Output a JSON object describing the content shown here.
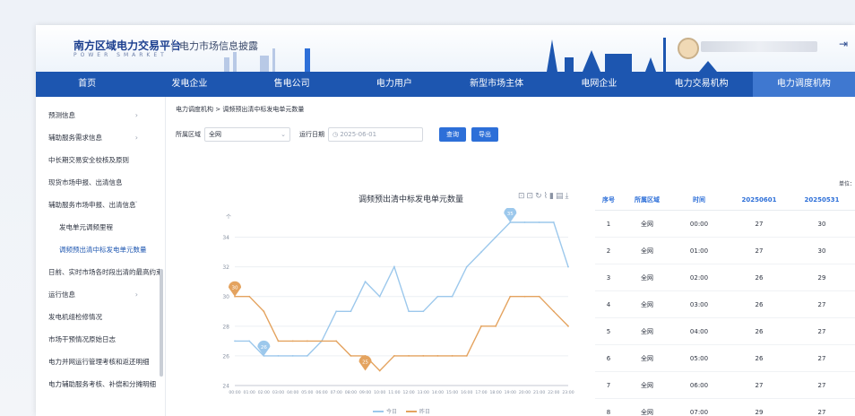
{
  "header": {
    "platform_title": "南方区域电力交易平台",
    "platform_subtitle_en": "POWER SMARKET",
    "site_title": "电力市场信息披露"
  },
  "nav": {
    "items": [
      {
        "label": "首页"
      },
      {
        "label": "发电企业"
      },
      {
        "label": "售电公司"
      },
      {
        "label": "电力用户"
      },
      {
        "label": "新型市场主体"
      },
      {
        "label": "电网企业"
      },
      {
        "label": "电力交易机构"
      },
      {
        "label": "电力调度机构",
        "active": true
      }
    ]
  },
  "sidebar": {
    "items": [
      {
        "label": "预测信息",
        "chevron": "›"
      },
      {
        "label": "辅助服务需求信息",
        "chevron": "›"
      },
      {
        "label": "中长期交易安全校核及原则"
      },
      {
        "label": "现货市场申报、出清信息"
      },
      {
        "label": "辅助服务市场申报、出清信息",
        "chevron": "ˇ"
      },
      {
        "label": "发电单元调频里程",
        "sub": true
      },
      {
        "label": "调频预出清中标发电单元数量",
        "sub": true,
        "active": true
      },
      {
        "label": "日前、实时市场各时段出清的最高约束"
      },
      {
        "label": "运行信息",
        "chevron": "›"
      },
      {
        "label": "发电机组检修情况"
      },
      {
        "label": "市场干预情况原始日志"
      },
      {
        "label": "电力并网运行管理考核和返还明细"
      },
      {
        "label": "电力辅助服务考核、补偿和分摊明细"
      }
    ]
  },
  "content": {
    "breadcrumb": "电力调度机构 > 调频预出清中标发电单元数量",
    "filters": {
      "region_label": "所属区域",
      "region_value": "全网",
      "date_label": "运行日期",
      "date_value": "2025-06-01",
      "query_button": "查询",
      "export_button": "导出"
    },
    "unit_label": "单位："
  },
  "chart_data": {
    "type": "line",
    "title": "调频预出清中标发电单元数量",
    "ylabel": "个",
    "ylim": [
      24,
      35
    ],
    "yticks": [
      24,
      26,
      28,
      30,
      32,
      34
    ],
    "x": [
      "00:00",
      "01:00",
      "02:00",
      "03:00",
      "04:00",
      "05:00",
      "06:00",
      "07:00",
      "08:00",
      "09:00",
      "10:00",
      "11:00",
      "12:00",
      "13:00",
      "14:00",
      "15:00",
      "16:00",
      "17:00",
      "18:00",
      "19:00",
      "20:00",
      "21:00",
      "22:00",
      "23:00"
    ],
    "series": [
      {
        "name": "今日",
        "color": "#9cc8ec",
        "values": [
          27,
          27,
          26,
          26,
          26,
          26,
          27,
          29,
          29,
          31,
          30,
          32,
          29,
          29,
          30,
          30,
          32,
          33,
          34,
          35,
          35,
          35,
          35,
          32
        ]
      },
      {
        "name": "昨日",
        "color": "#e4a35f",
        "values": [
          30,
          30,
          29,
          27,
          27,
          27,
          27,
          27,
          26,
          26,
          25,
          26,
          26,
          26,
          26,
          26,
          26,
          28,
          28,
          30,
          30,
          30,
          29,
          28
        ]
      }
    ],
    "markers": [
      {
        "series": 0,
        "label": "26",
        "index": 2,
        "value": 26
      },
      {
        "series": 0,
        "label": "35",
        "index": 19,
        "value": 35
      },
      {
        "series": 1,
        "label": "30",
        "index": 0,
        "value": 30
      },
      {
        "series": 1,
        "label": "25",
        "index": 9,
        "value": 25
      }
    ],
    "grid": true,
    "legend_position": "bottom"
  },
  "table": {
    "headers": [
      "序号",
      "所属区域",
      "时间",
      "20250601",
      "20250531"
    ],
    "rows": [
      [
        "1",
        "全网",
        "00:00",
        "27",
        "30"
      ],
      [
        "2",
        "全网",
        "01:00",
        "27",
        "30"
      ],
      [
        "3",
        "全网",
        "02:00",
        "26",
        "29"
      ],
      [
        "4",
        "全网",
        "03:00",
        "26",
        "27"
      ],
      [
        "5",
        "全网",
        "04:00",
        "26",
        "27"
      ],
      [
        "6",
        "全网",
        "05:00",
        "26",
        "27"
      ],
      [
        "7",
        "全网",
        "06:00",
        "27",
        "27"
      ],
      [
        "8",
        "全网",
        "07:00",
        "29",
        "27"
      ]
    ]
  },
  "toolbox_icons": [
    "zoom-icon",
    "reset-zoom-icon",
    "restore-icon",
    "line-switch-icon",
    "bar-switch-icon",
    "data-view-icon",
    "download-icon"
  ]
}
